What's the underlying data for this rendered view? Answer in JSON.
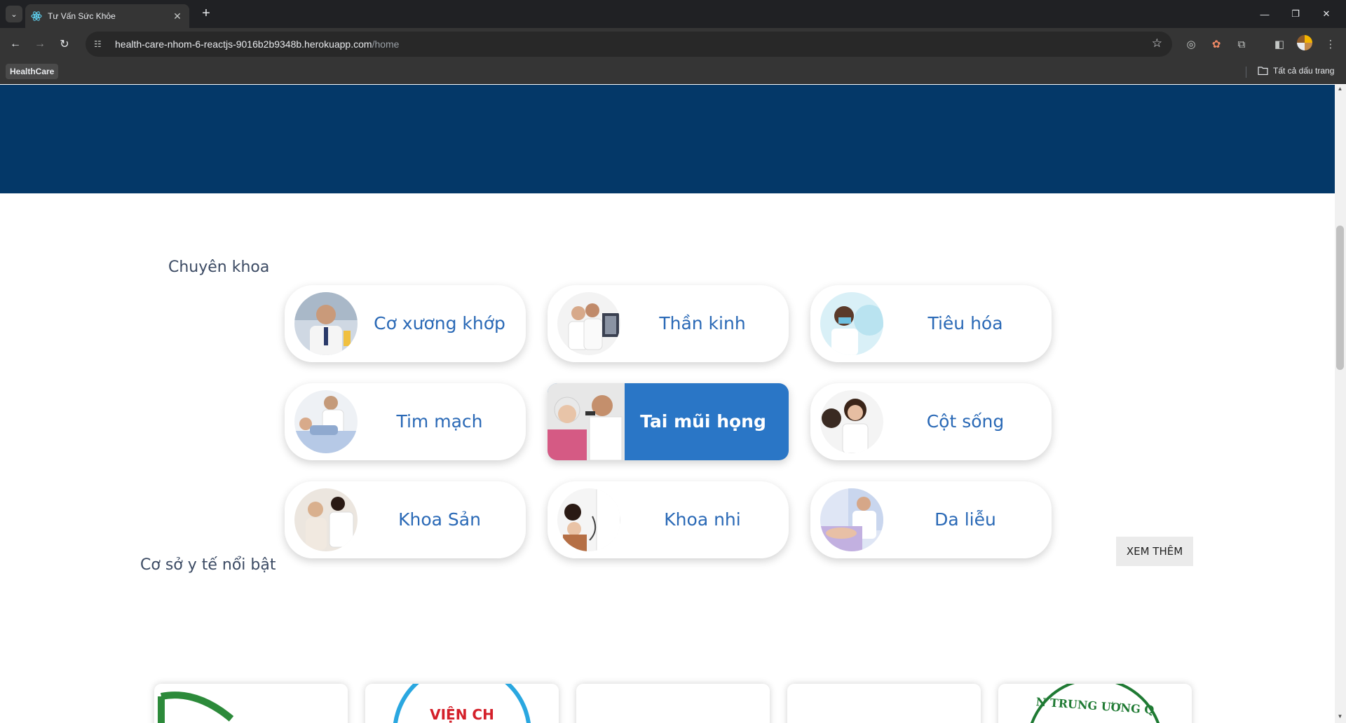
{
  "browser": {
    "tab_title": "Tư Vấn Sức Khỏe",
    "url_host": "health-care-nhom-6-reactjs-9016b2b9348b.herokuapp.com",
    "url_path": "/home",
    "bookmark_chip": "HealthCare",
    "all_bookmarks": "Tất cả dấu trang"
  },
  "specialties": {
    "title": "Chuyên khoa",
    "items": [
      {
        "label": "Cơ xương khớp",
        "active": false
      },
      {
        "label": "Thần kinh",
        "active": false
      },
      {
        "label": "Tiêu hóa",
        "active": false
      },
      {
        "label": "Tim mạch",
        "active": false
      },
      {
        "label": "Tai mũi họng",
        "active": true
      },
      {
        "label": "Cột sống",
        "active": false
      },
      {
        "label": "Khoa Sản",
        "active": false
      },
      {
        "label": "Khoa nhi",
        "active": false
      },
      {
        "label": "Da liễu",
        "active": false
      }
    ]
  },
  "facilities": {
    "title": "Cơ sở y tế nổi bật",
    "more_label": "XEM THÊM",
    "logo_text_2": "VIỆN CH",
    "logo_text_5": "N TRUNG ƯƠNG Q"
  },
  "colors": {
    "hero": "#043868",
    "accent": "#2a76c6",
    "specialty_text": "#2a69b6"
  }
}
